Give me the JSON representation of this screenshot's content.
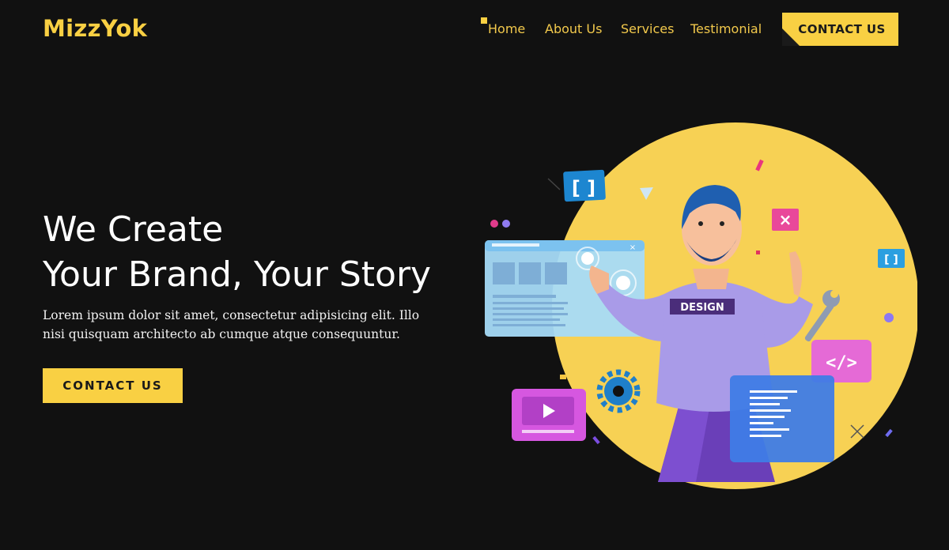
{
  "brand": {
    "name": "MizzYok"
  },
  "nav": {
    "items": [
      {
        "label": "Home"
      },
      {
        "label": "About Us"
      },
      {
        "label": "Services"
      },
      {
        "label": "Testimonial"
      }
    ],
    "cta_label": "CONTACT US"
  },
  "hero": {
    "title_line1": "We Create",
    "title_line2": "Your Brand, Your Story",
    "description": "Lorem ipsum dolor sit amet, consectetur adipisicing elit. Illo nisi quisquam architecto ab cumque atque consequuntur.",
    "cta_label": "CONTACT US"
  },
  "illustration": {
    "shirt_text": "DESIGN",
    "icons": [
      "brackets-icon",
      "close-icon",
      "code-icon",
      "play-icon",
      "gear-icon",
      "wrench-icon"
    ]
  },
  "colors": {
    "accent": "#f9d043",
    "background": "#111111",
    "text": "#ffffff"
  }
}
